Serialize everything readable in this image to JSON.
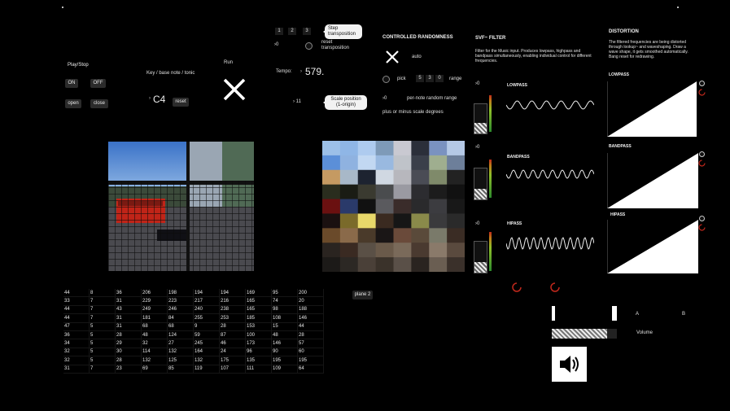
{
  "play_stop": {
    "title": "Play/Stop",
    "on": "ON",
    "off": "OFF",
    "open": "open",
    "close": "close"
  },
  "key": {
    "label": "Key / base note / tonic",
    "value": "C4",
    "reset": "reset"
  },
  "run": {
    "label": "Run"
  },
  "step_transposition": {
    "buttons": [
      "1",
      "2",
      "3"
    ],
    "zero": "0",
    "bubble": "Step transposition",
    "reset_label": "reset transposition"
  },
  "tempo": {
    "label": "Tempo:",
    "value": "579."
  },
  "scale_position": {
    "value": "11",
    "bubble": "Scale position (1-origin)"
  },
  "randomness": {
    "title": "CONTROLLED RANDOMNESS",
    "auto": "auto",
    "pick": "pick",
    "pick_values": [
      "5",
      "3",
      "0"
    ],
    "range": "range",
    "per_note_value": "0",
    "per_note_label": "per-note random range",
    "plus_minus": "plus or minus scale degrees"
  },
  "svf": {
    "title": "SVF~ FILTER",
    "description": "Filter for the Music input. Produces lowpass, highpass and bandpass simultaneously, enabling individual control for different frequencies.",
    "lowpass": "LOWPASS",
    "bandpass": "BANDPASS",
    "hipass": "HIPASS",
    "meter_values": [
      "0",
      "0",
      "0"
    ],
    "meter_levels": [
      0.35,
      0.35,
      0.35
    ]
  },
  "distortion": {
    "title": "DISTORTION",
    "description": "The filtered frequencies are being distorted through lookup~ and waveshaping. Draw a wave shape, it gets smoothed automatically. Bang reset for redrawing.",
    "lowpass": "LOWPASS",
    "bandpass": "BANDPASS",
    "hipass": "HIPASS"
  },
  "mixer": {
    "a": "A",
    "b": "B",
    "volume_label": "Volume",
    "volume_level": 0.85
  },
  "plane_label": "plane 2",
  "matrix": [
    [
      "44",
      "8",
      "36",
      "206",
      "198",
      "194",
      "194",
      "169",
      "95",
      "200"
    ],
    [
      "33",
      "7",
      "31",
      "229",
      "223",
      "217",
      "216",
      "165",
      "74",
      "20"
    ],
    [
      "44",
      "7",
      "43",
      "249",
      "246",
      "240",
      "238",
      "165",
      "98",
      "188"
    ],
    [
      "44",
      "7",
      "31",
      "181",
      "84",
      "255",
      "253",
      "185",
      "108",
      "146"
    ],
    [
      "47",
      "5",
      "31",
      "68",
      "68",
      "9",
      "28",
      "153",
      "15",
      "44"
    ],
    [
      "36",
      "5",
      "28",
      "48",
      "124",
      "59",
      "87",
      "100",
      "48",
      "28"
    ],
    [
      "34",
      "5",
      "29",
      "32",
      "27",
      "245",
      "46",
      "173",
      "146",
      "57"
    ],
    [
      "32",
      "5",
      "30",
      "114",
      "132",
      "164",
      "24",
      "96",
      "90",
      "60"
    ],
    [
      "32",
      "5",
      "28",
      "132",
      "125",
      "132",
      "175",
      "135",
      "195",
      "195"
    ],
    [
      "31",
      "7",
      "23",
      "69",
      "85",
      "119",
      "107",
      "111",
      "109",
      "64"
    ]
  ],
  "colors": {
    "accent_red": "#c0281c",
    "meter_green": "#2c8a2c",
    "bubble_bg": "#f2f2f2"
  },
  "icons": {
    "run": "x-icon",
    "auto": "x-icon",
    "speaker": "speaker-icon"
  }
}
